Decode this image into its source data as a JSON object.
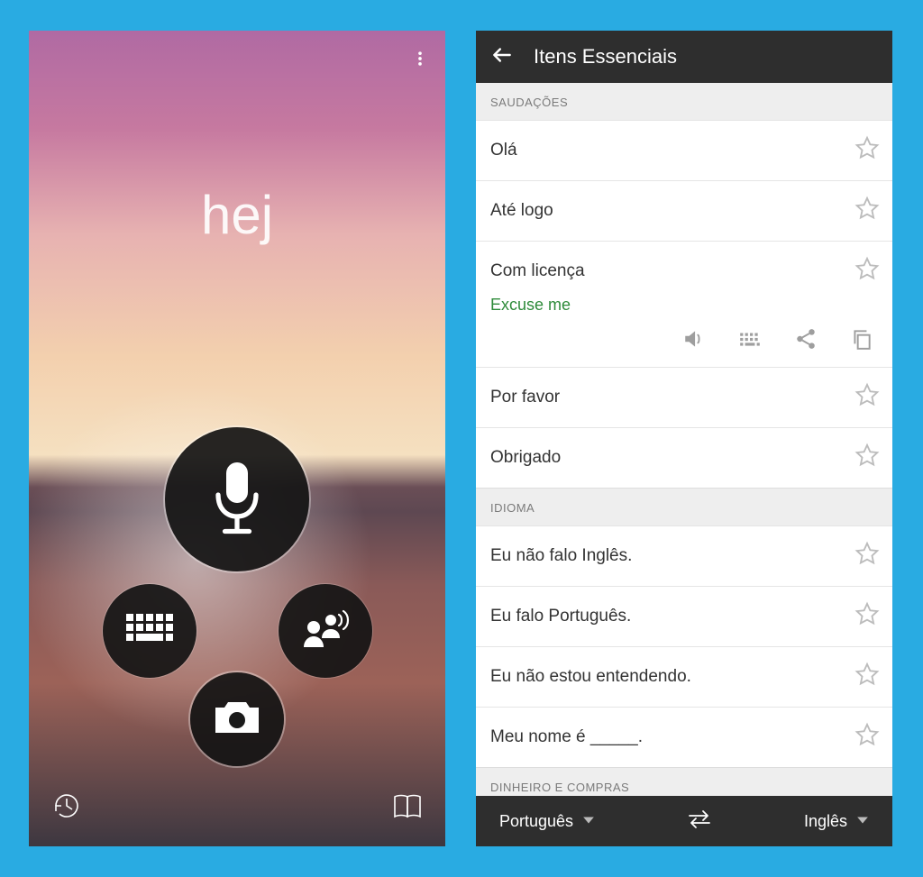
{
  "left": {
    "word": "hej"
  },
  "right": {
    "title": "Itens Essenciais",
    "sections": [
      {
        "header": "SAUDAÇÕES"
      },
      {
        "header": "IDIOMA"
      },
      {
        "header": "DINHEIRO E COMPRAS"
      }
    ],
    "phrases_greetings": [
      {
        "text": "Olá"
      },
      {
        "text": "Até logo"
      },
      {
        "text": "Com licença",
        "translation": "Excuse me",
        "expanded": true
      },
      {
        "text": "Por favor"
      },
      {
        "text": "Obrigado"
      }
    ],
    "phrases_language": [
      {
        "text": "Eu não falo Inglês."
      },
      {
        "text": "Eu falo Português."
      },
      {
        "text": "Eu não estou entendendo."
      },
      {
        "text": "Meu nome é _____."
      }
    ],
    "footer": {
      "lang_from": "Português",
      "lang_to": "Inglês"
    }
  }
}
